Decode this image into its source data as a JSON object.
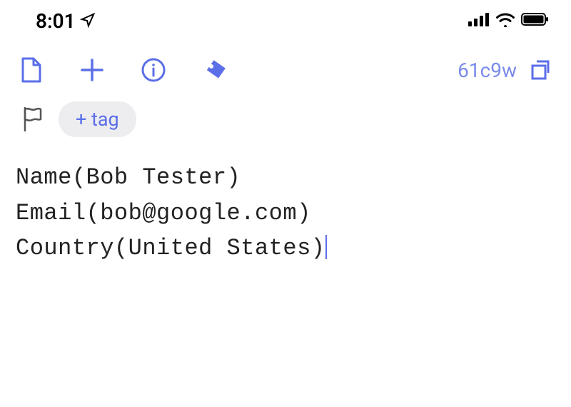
{
  "status_bar": {
    "time": "8:01"
  },
  "toolbar": {
    "doc_id": "61c9w"
  },
  "tag_row": {
    "add_tag_label": "+ tag"
  },
  "content": {
    "line1": "Name(Bob Tester)",
    "line2": "Email(bob@google.com)",
    "line3": "Country(United States)"
  },
  "colors": {
    "accent": "#5B6FE8",
    "accent_light": "#7a8bea",
    "text": "#222",
    "pill_bg": "#ededf0"
  }
}
